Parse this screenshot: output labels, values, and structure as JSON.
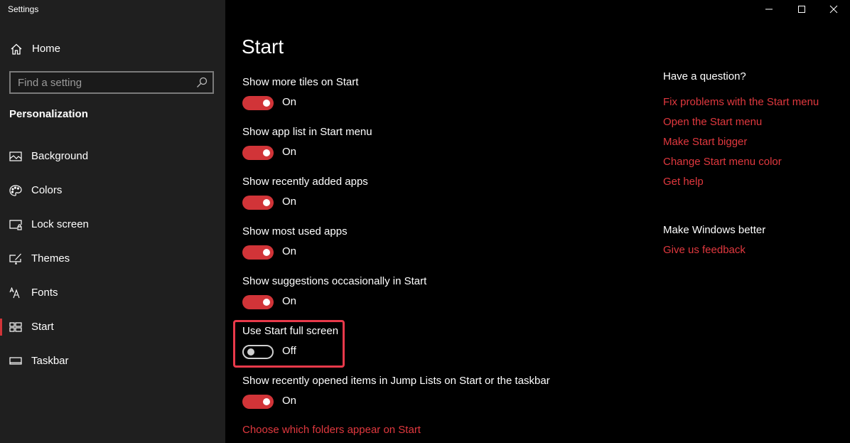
{
  "window": {
    "title": "Settings",
    "controls": {
      "minimize": "minimize-icon",
      "maximize": "maximize-icon",
      "close": "close-icon"
    }
  },
  "sidebar": {
    "home": {
      "label": "Home",
      "icon": "home-icon"
    },
    "search": {
      "placeholder": "Find a setting",
      "value": "",
      "icon": "search-icon"
    },
    "section_title": "Personalization",
    "items": [
      {
        "label": "Background",
        "icon": "picture-icon",
        "active": false
      },
      {
        "label": "Colors",
        "icon": "palette-icon",
        "active": false
      },
      {
        "label": "Lock screen",
        "icon": "lock-screen-icon",
        "active": false
      },
      {
        "label": "Themes",
        "icon": "themes-brush-icon",
        "active": false
      },
      {
        "label": "Fonts",
        "icon": "fonts-icon",
        "active": false
      },
      {
        "label": "Start",
        "icon": "start-tiles-icon",
        "active": true
      },
      {
        "label": "Taskbar",
        "icon": "taskbar-icon",
        "active": false
      }
    ]
  },
  "main": {
    "title": "Start",
    "settings": [
      {
        "label": "Show more tiles on Start",
        "on": true,
        "state": "On"
      },
      {
        "label": "Show app list in Start menu",
        "on": true,
        "state": "On"
      },
      {
        "label": "Show recently added apps",
        "on": true,
        "state": "On"
      },
      {
        "label": "Show most used apps",
        "on": true,
        "state": "On"
      },
      {
        "label": "Show suggestions occasionally in Start",
        "on": true,
        "state": "On"
      },
      {
        "label": "Use Start full screen",
        "on": false,
        "state": "Off",
        "highlighted": true
      },
      {
        "label": "Show recently opened items in Jump Lists on Start or the taskbar",
        "on": true,
        "state": "On"
      }
    ],
    "folders_link": "Choose which folders appear on Start"
  },
  "aside": {
    "question_title": "Have a question?",
    "help_links": [
      "Fix problems with the Start menu",
      "Open the Start menu",
      "Make Start bigger",
      "Change Start menu color",
      "Get help"
    ],
    "better_title": "Make Windows better",
    "feedback_link": "Give us feedback"
  },
  "colors": {
    "accent": "#d13438",
    "link": "#e0383e",
    "highlight_border": "#e8394a",
    "sidebar_bg": "#1f1f1f",
    "main_bg": "#000000"
  }
}
